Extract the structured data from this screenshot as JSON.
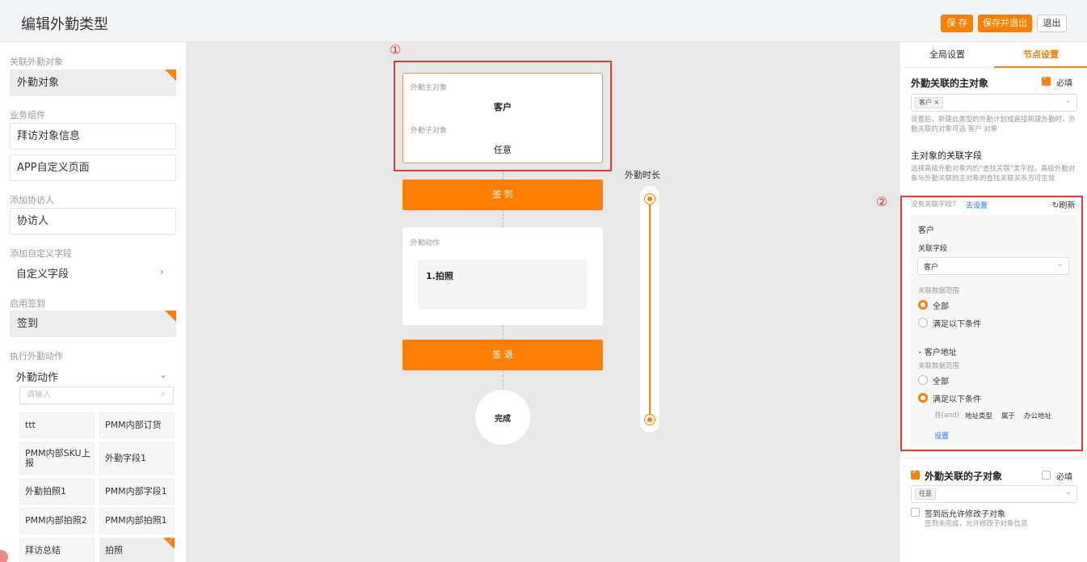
{
  "header": {
    "title": "编辑外勤类型",
    "save": "保 存",
    "save_exit": "保存并退出",
    "exit": "退出"
  },
  "left": {
    "related_obj_label": "关联外勤对象",
    "related_obj_value": "外勤对象",
    "business_label": "业务组件",
    "business_items": [
      "拜访对象信息",
      "APP自定义页面"
    ],
    "assist_label": "添加协访人",
    "assist_value": "协访人",
    "custom_label": "添加自定义字段",
    "custom_value": "自定义字段",
    "checkin_label": "启用签到",
    "checkin_value": "签到",
    "action_label": "执行外勤动作",
    "action_value": "外勤动作",
    "search_placeholder": "请输入",
    "grid": [
      "ttt",
      "PMM内部订货",
      "PMM内部SKU上报",
      "外勤字段1",
      "外勤拍照1",
      "PMM内部字段1",
      "PMM内部拍照2",
      "PMM内部拍照1",
      "拜访总结",
      "拍照"
    ]
  },
  "canvas": {
    "marker1": "①",
    "main_obj_label": "外勤主对象",
    "main_obj_value": "客户",
    "sub_obj_label": "外勤子对象",
    "sub_obj_value": "任意",
    "checkin": "签 到",
    "action_label": "外勤动作",
    "action_item": "1.拍照",
    "checkout": "签 退",
    "done": "完成",
    "duration_label": "外勤时长"
  },
  "right": {
    "tab_global": "全局设置",
    "tab_node": "节点设置",
    "main_title": "外勤关联的主对象",
    "required": "必填",
    "main_tag": "客户",
    "main_desc": "设置后，新建此类型的外勤计划或直接新建外勤时，外勤关联的对象可选 客户 对象",
    "rel_title": "主对象的关联字段",
    "rel_desc": "选择高级外勤对象内的\"查找关联\"类字段，高级外勤对象与外勤关联的主对象的查找关联关系方可生效",
    "marker2": "②",
    "no_field": "没有关联字段?",
    "go_set": "去设置",
    "refresh": "刷新",
    "block_title": "客户",
    "field_label": "关联字段",
    "field_value": "客户",
    "scope_label": "关联数据范围",
    "opt_all": "全部",
    "opt_cond": "满足以下条件",
    "addr_title": "客户地址",
    "addr_scope_label": "关联数据范围",
    "cond_and": "且(and)",
    "cond_field": "地址类型",
    "cond_op": "属于",
    "cond_val": "办公地址",
    "set_link": "设置",
    "sub_title": "外勤关联的子对象",
    "sub_required": "必填",
    "sub_tag": "任意",
    "allow_edit": "签到后允许修改子对象",
    "allow_desc": "签到未完成，允许修改子对象信息"
  }
}
